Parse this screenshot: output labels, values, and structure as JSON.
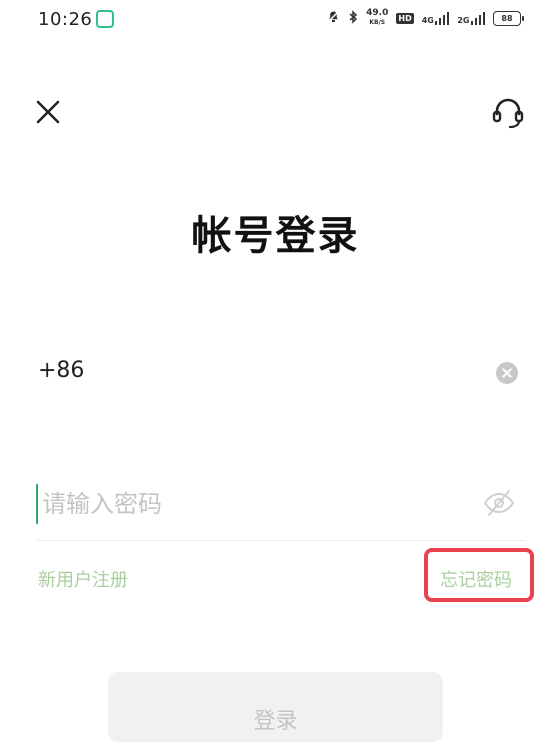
{
  "status_bar": {
    "time": "10:26",
    "speed_value": "49.0",
    "speed_unit": "KB/S",
    "hd_label": "HD",
    "net_label_1": "4G",
    "net_label_2": "2G",
    "battery": "88",
    "icons": [
      "app-icon",
      "notification-muted-icon",
      "bluetooth-icon",
      "signal-icon",
      "battery-icon"
    ]
  },
  "nav": {
    "close_icon": "close-icon",
    "support_icon": "headset-icon"
  },
  "page": {
    "title": "帐号登录"
  },
  "form": {
    "phone_prefix": "+86",
    "password_placeholder": "请输入密码",
    "password_value": ""
  },
  "links": {
    "register": "新用户注册",
    "forgot_password": "忘记密码"
  },
  "actions": {
    "login": "登录"
  },
  "colors": {
    "link": "#a9cf9d",
    "highlight": "#e9424f",
    "accent": "#2fc08a",
    "button_bg": "#f1f1f1"
  }
}
